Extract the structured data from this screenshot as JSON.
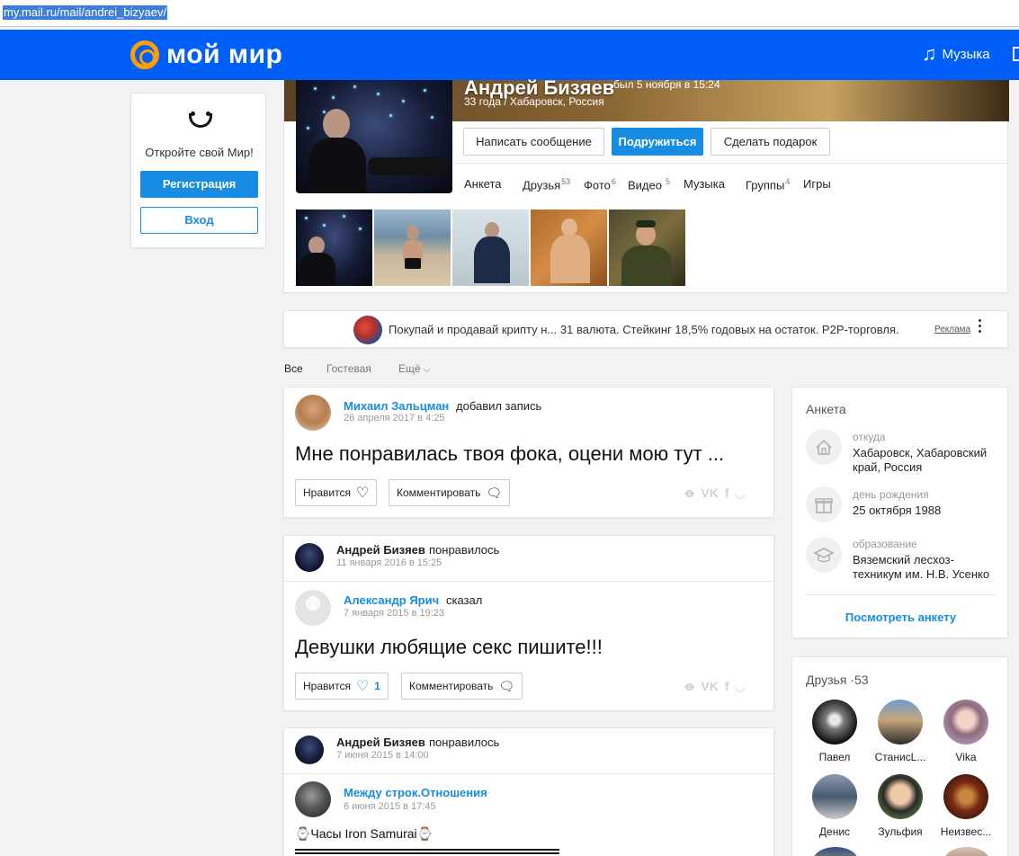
{
  "browser": {
    "url": "my.mail.ru/mail/andrei_bizyaev/"
  },
  "header": {
    "logo_text": "мой мир",
    "music_label": "Музыка",
    "brand_color": "#005ff9",
    "logo_color": "#ff9e00"
  },
  "register": {
    "prompt": "Откройте свой Мир!",
    "register_label": "Регистрация",
    "login_label": "Вход"
  },
  "profile": {
    "name": "Андрей Бизяев",
    "last_seen": "был 5 ноября в 15:24",
    "info": "33 года / Хабаровск, Россия",
    "buttons": {
      "message": "Написать сообщение",
      "befriend": "Подружиться",
      "gift": "Сделать подарок"
    },
    "tabs": [
      {
        "label": "Анкета",
        "count": ""
      },
      {
        "label": "Друзья",
        "count": "53"
      },
      {
        "label": "Фото",
        "count": "6"
      },
      {
        "label": "Видео",
        "count": "5"
      },
      {
        "label": "Музыка",
        "count": ""
      },
      {
        "label": "Группы",
        "count": "4"
      },
      {
        "label": "Игры",
        "count": ""
      }
    ]
  },
  "ad": {
    "text": "Покупай и продавай крипту н... 31 валюта. Стейкинг 18,5% годовых на остаток. P2P-торговля.",
    "label": "Реклама"
  },
  "feed_tabs": {
    "all": "Все",
    "guest": "Гостевая",
    "more": "Ещё"
  },
  "posts": [
    {
      "author": "Михаил Зальцман",
      "action": "добавил запись",
      "time": "26 апреля 2017 в 4:25",
      "text": "Мне понравилась твоя фока, оцени мою тут ...",
      "like_label": "Нравится",
      "like_count": "",
      "comment_label": "Комментировать"
    },
    {
      "liker": "Андрей Бизяев",
      "liker_action": "понравилось",
      "liker_time": "11 января 2016 в 15:25",
      "author": "Александр Ярич",
      "action": "сказал",
      "time": "7 января 2015 в 19:23",
      "text": "Девушки любящие секс пишите!!!",
      "like_label": "Нравится",
      "like_count": "1",
      "comment_label": "Комментировать"
    },
    {
      "liker": "Андрей Бизяев",
      "liker_action": "понравилось",
      "liker_time": "7 июня 2015 в 14:00",
      "author": "Между строк.Отношения",
      "time": "6 июня 2015 в 17:45",
      "text": "⌚Часы Iron Samurai⌚"
    }
  ],
  "anketa": {
    "title": "Анкета",
    "rows": [
      {
        "label": "откуда",
        "value": "Хабаровск, Хабаровский край, Россия",
        "icon": "home-icon"
      },
      {
        "label": "день рождения",
        "value": "25 октября 1988",
        "icon": "gift-icon"
      },
      {
        "label": "образование",
        "value": "Вяземский лесхоз-техникум им. Н.В. Усенко",
        "icon": "graduation-cap-icon"
      }
    ],
    "view_link": "Посмотреть анкету"
  },
  "friends": {
    "title": "Друзья",
    "count": "53",
    "list": [
      "Павел",
      "СтанисL...",
      "Vika",
      "Денис",
      "Зульфия",
      "Неизвес..."
    ]
  }
}
